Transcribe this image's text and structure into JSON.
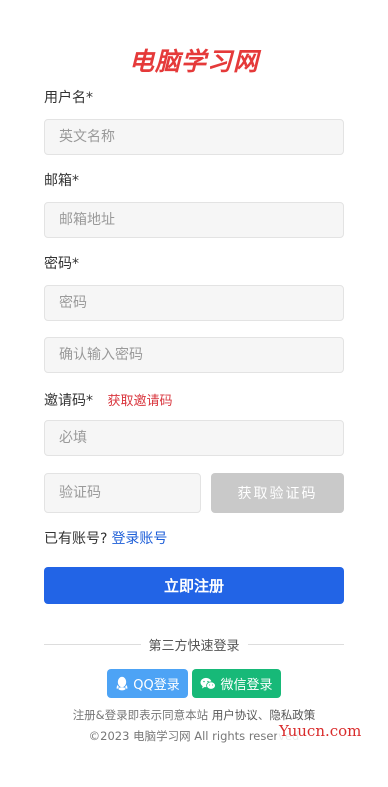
{
  "brand": {
    "logo_text": "电脑学习网"
  },
  "form": {
    "username": {
      "label": "用户名*",
      "placeholder": "英文名称",
      "value": ""
    },
    "email": {
      "label": "邮箱*",
      "placeholder": "邮箱地址",
      "value": ""
    },
    "password": {
      "label": "密码*",
      "placeholder": "密码",
      "value": ""
    },
    "password_confirm": {
      "placeholder": "确认输入密码",
      "value": ""
    },
    "invite": {
      "label": "邀请码*",
      "link": "获取邀请码",
      "placeholder": "必填",
      "value": ""
    },
    "captcha": {
      "placeholder": "验证码",
      "value": "",
      "button": "获取验证码"
    },
    "have_account_text": "已有账号?",
    "login_link": "登录账号",
    "submit_label": "立即注册"
  },
  "third_party": {
    "divider_text": "第三方快速登录",
    "qq_label": "QQ登录",
    "wechat_label": "微信登录"
  },
  "footer": {
    "agree_text": "注册&登录即表示同意本站",
    "terms_link": "用户协议",
    "separator": "、",
    "privacy_link": "隐私政策",
    "copyright": "©2023 电脑学习网 All rights reserved"
  },
  "watermark": "Yuucn.com",
  "colors": {
    "primary": "#2264e6",
    "logo_red": "#e53a3a",
    "qq_blue": "#4da3f5",
    "wechat_green": "#17b978",
    "disabled_gray": "#c9c9c9"
  }
}
